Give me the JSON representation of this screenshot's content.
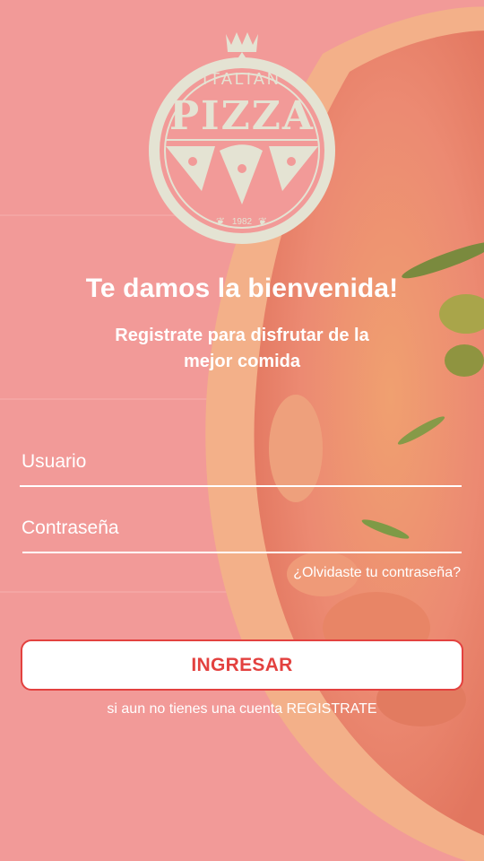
{
  "logo": {
    "top_text": "ITALIAN",
    "main_text": "PIZZA",
    "year": "1982",
    "color": "#e4e3d3"
  },
  "header": {
    "title": "Te damos la bienvenida!",
    "subtitle": "Registrate para disfrutar de la mejor comida"
  },
  "form": {
    "username_placeholder": "Usuario",
    "password_placeholder": "Contraseña",
    "forgot_label": "¿Olvidaste tu contraseña?",
    "login_label": "INGRESAR"
  },
  "footer": {
    "prefix": "si aun no tienes una cuenta",
    "register_label": "REGISTRATE"
  },
  "colors": {
    "background": "#f29a98",
    "accent": "#e3413f",
    "text": "#ffffff"
  }
}
